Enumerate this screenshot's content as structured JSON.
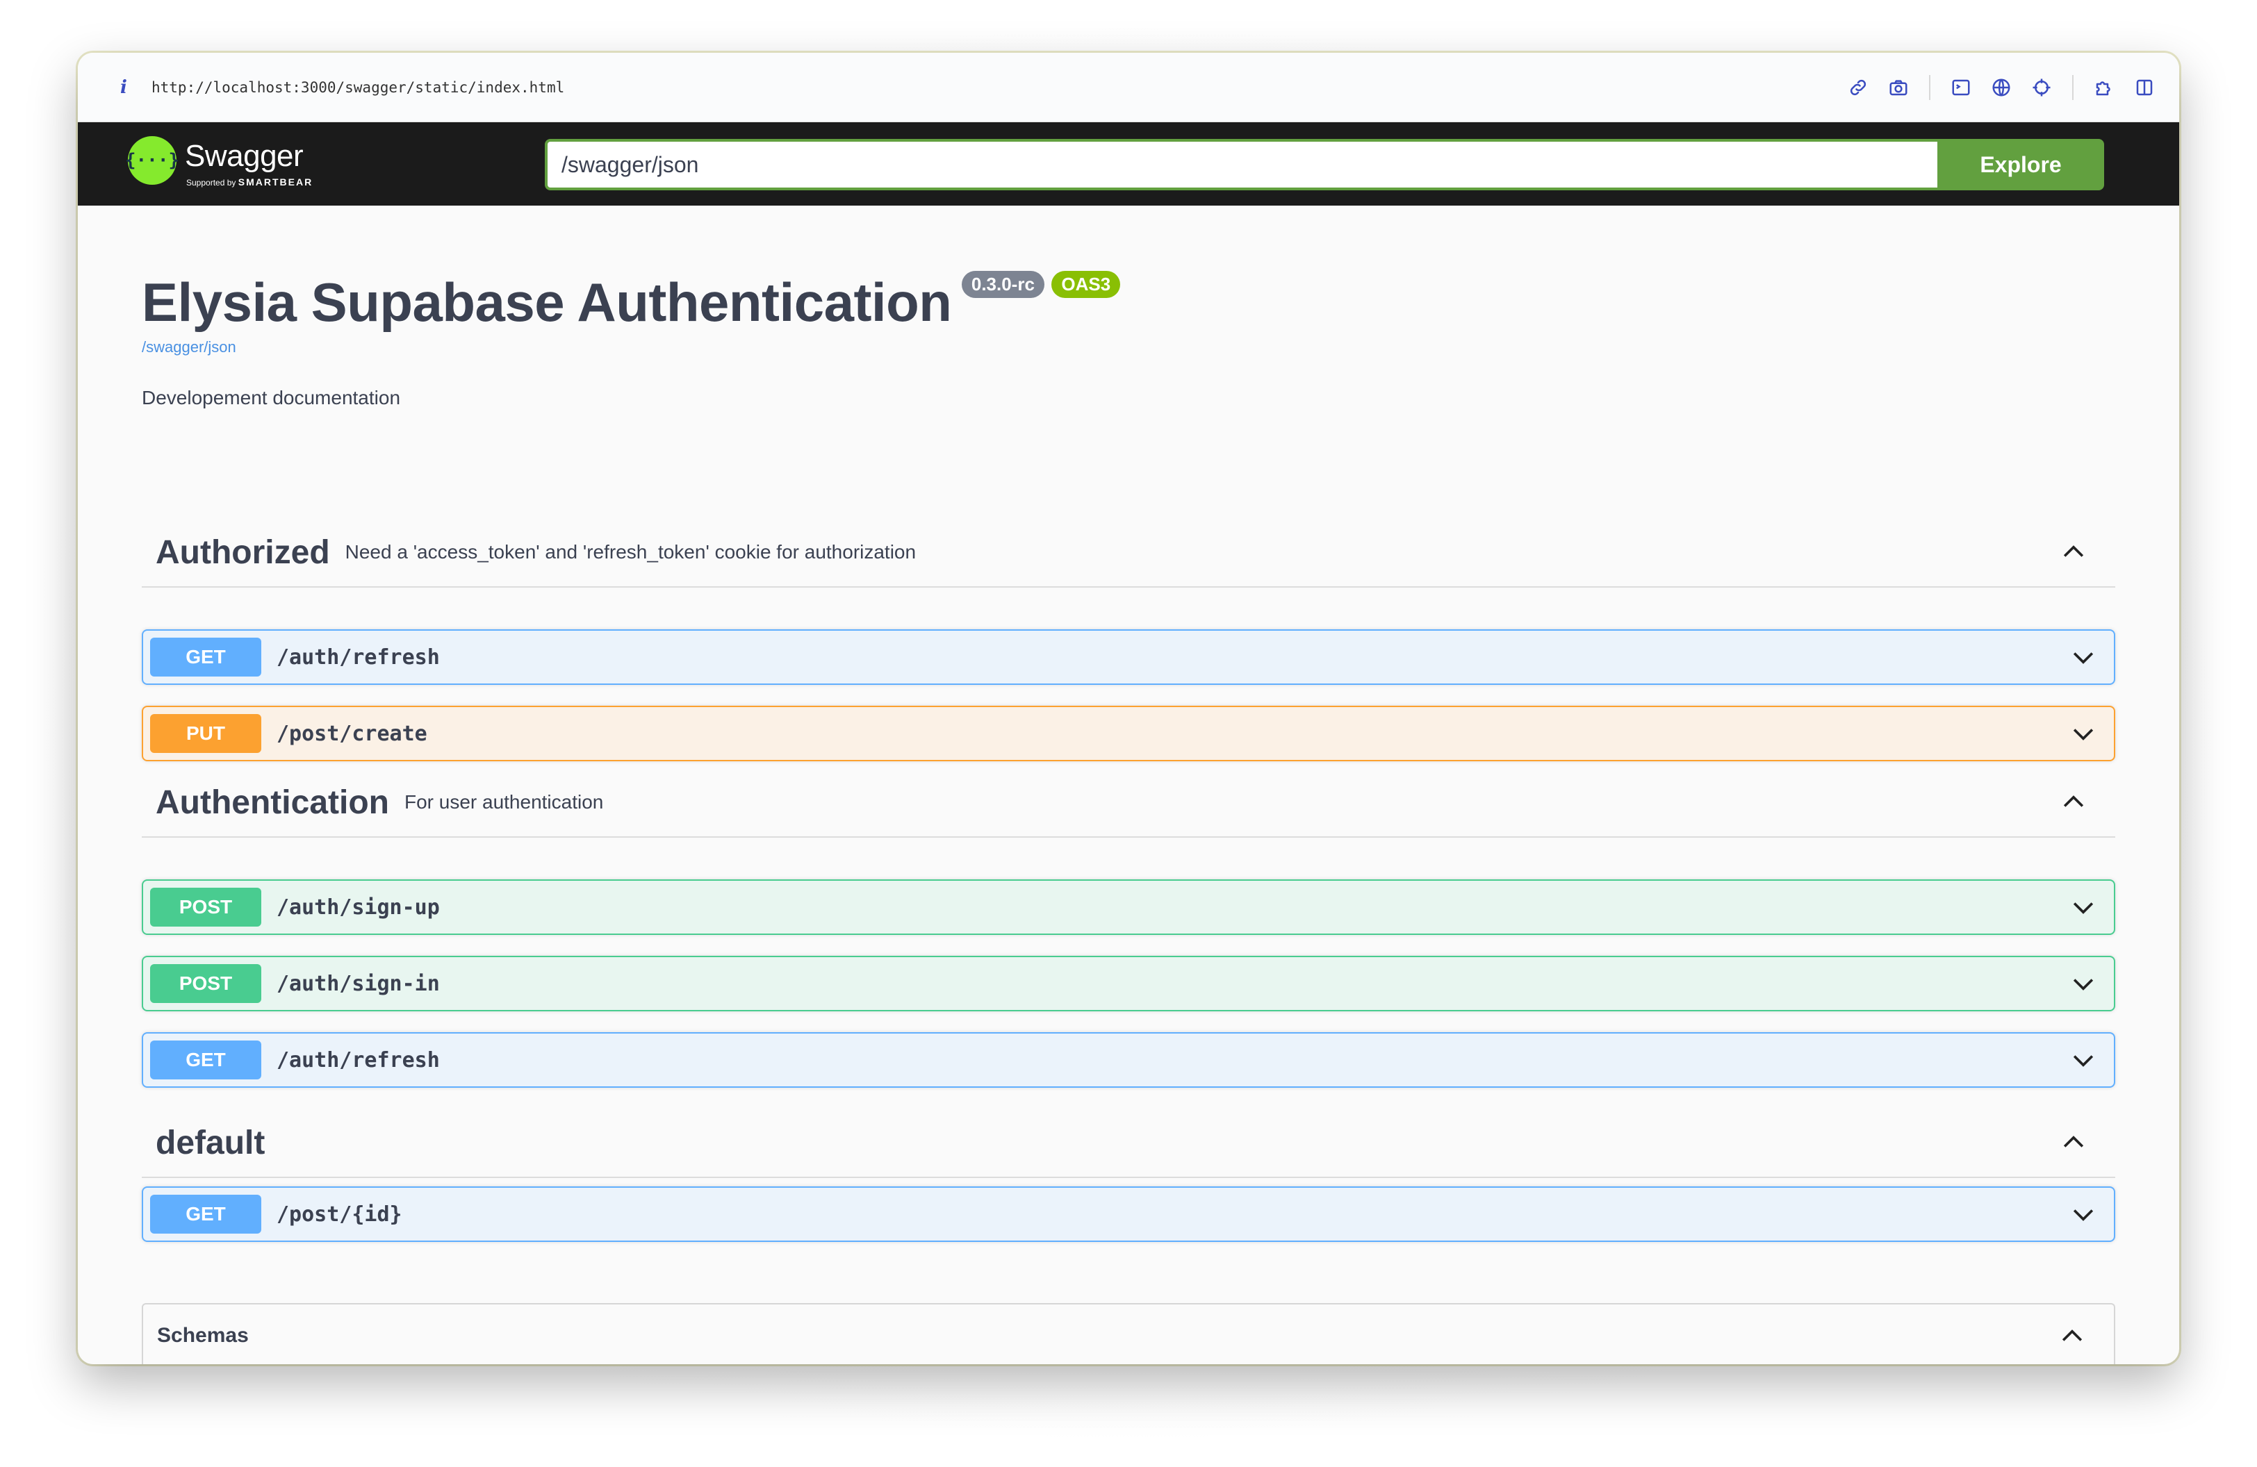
{
  "browser": {
    "url": "http://localhost:3000/swagger/static/index.html",
    "icons": [
      "link-icon",
      "camera-icon",
      "terminal-icon",
      "globe-icon",
      "crosshair-icon",
      "extensions-icon",
      "sidebar-icon"
    ]
  },
  "topbar": {
    "logo_text": "Swagger",
    "logo_glyph": "{···}",
    "logo_sub_prefix": "Supported by",
    "logo_sub_brand": "SMARTBEAR",
    "explore_value": "/swagger/json",
    "explore_label": "Explore"
  },
  "info": {
    "title": "Elysia Supabase Authentication",
    "version": "0.3.0-rc",
    "oas_badge": "OAS3",
    "spec_link": "/swagger/json",
    "description": "Developement documentation"
  },
  "tags": [
    {
      "name": "Authorized",
      "description": "Need a 'access_token' and 'refresh_token' cookie for authorization",
      "operations": [
        {
          "method": "GET",
          "path": "/auth/refresh"
        },
        {
          "method": "PUT",
          "path": "/post/create"
        }
      ]
    },
    {
      "name": "Authentication",
      "description": "For user authentication",
      "operations": [
        {
          "method": "POST",
          "path": "/auth/sign-up"
        },
        {
          "method": "POST",
          "path": "/auth/sign-in"
        },
        {
          "method": "GET",
          "path": "/auth/refresh"
        }
      ]
    },
    {
      "name": "default",
      "description": "",
      "operations": [
        {
          "method": "GET",
          "path": "/post/{id}"
        }
      ]
    }
  ],
  "schemas": {
    "title": "Schemas"
  },
  "colors": {
    "get": "#61affe",
    "put": "#fca130",
    "post": "#49cc90",
    "explore": "#62a03f",
    "logo": "#85ea2d"
  }
}
